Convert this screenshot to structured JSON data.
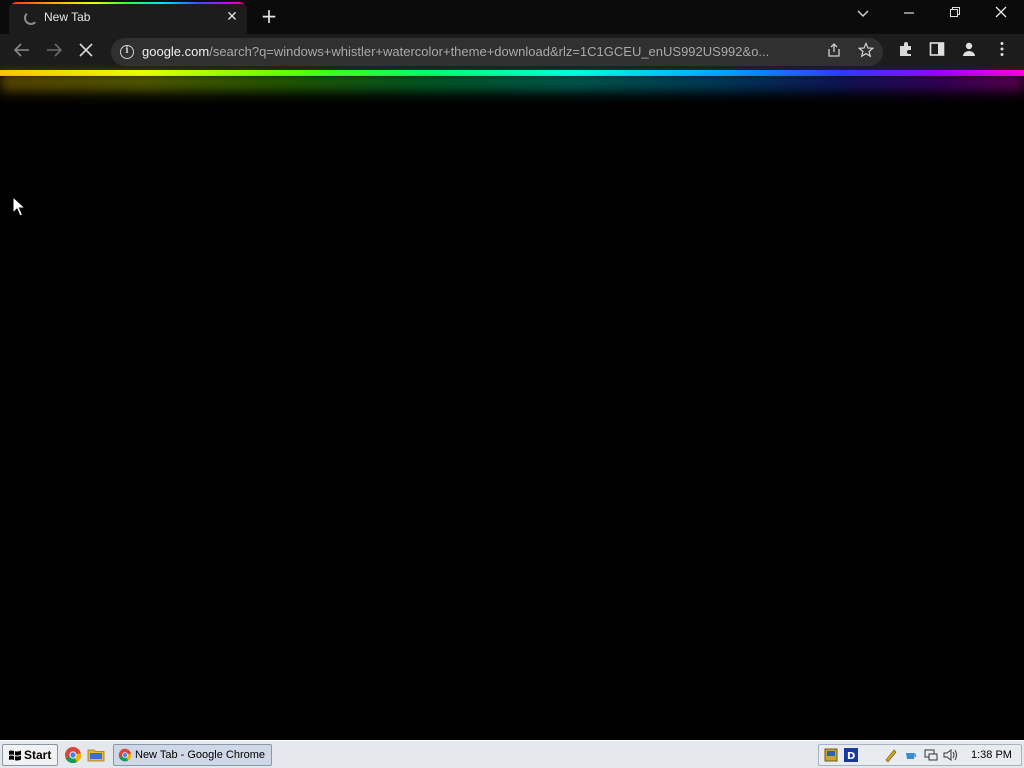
{
  "browser": {
    "tab": {
      "title": "New Tab",
      "close_glyph": "✕"
    },
    "new_tab_glyph": "+",
    "window_controls": {
      "dropdown": "⌄",
      "minimize": "—",
      "restore": "❐",
      "close": "✕"
    },
    "nav": {
      "back": "←",
      "forward": "→",
      "reload": "✕"
    },
    "address": {
      "host": "google.com",
      "path": "/search?q=windows+whistler+watercolor+theme+download&rlz=1C1GCEU_enUS992US992&o..."
    },
    "icons": {
      "info": "i",
      "share": "⇪",
      "bookmark": "☆",
      "extensions": "✚",
      "side_panel": "▯",
      "profile": "●",
      "menu": "⋮"
    }
  },
  "taskbar": {
    "start_label": "Start",
    "task_button_label": "New Tab - Google Chrome",
    "clock": "1:38 PM",
    "tray_icons": [
      "network-icon",
      "d-icon",
      "pen-icon",
      "cup-icon",
      "monitor-icon",
      "speaker-icon"
    ]
  },
  "colors": {
    "browser_bg": "#000000",
    "toolbar": "#1c1c1c",
    "taskbar": "#e4e7ec"
  }
}
